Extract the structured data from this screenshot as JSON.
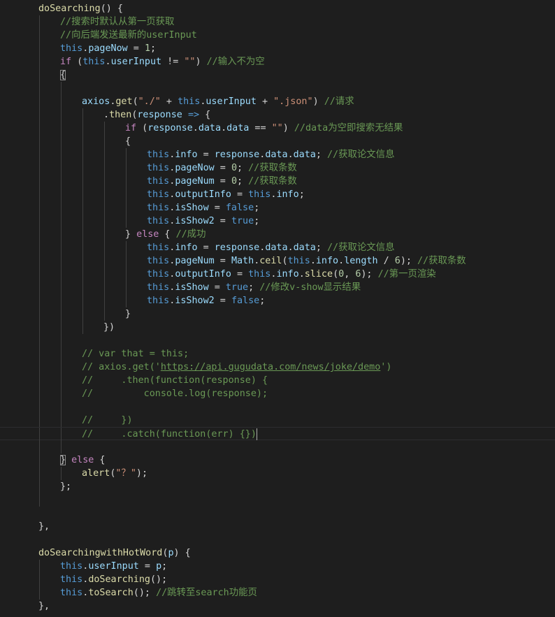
{
  "editor": {
    "language": "javascript",
    "theme": {
      "background": "#1e1e1e",
      "keyword": "#569cd6",
      "control": "#c586c0",
      "function": "#dcdcaa",
      "property": "#9cdcfe",
      "string": "#ce9178",
      "number": "#b5cea8",
      "comment": "#6a9955",
      "text": "#d4d4d4"
    },
    "lines": [
      {
        "indent": 1,
        "tokens": [
          [
            "fn",
            "doSearching"
          ],
          [
            "punc",
            "() {"
          ]
        ]
      },
      {
        "indent": 2,
        "tokens": [
          [
            "cmt",
            "//搜索时默认从第一页获取"
          ]
        ]
      },
      {
        "indent": 2,
        "tokens": [
          [
            "cmt",
            "//向后端发送最新的userInput"
          ]
        ]
      },
      {
        "indent": 2,
        "tokens": [
          [
            "kw",
            "this"
          ],
          [
            "punc",
            "."
          ],
          [
            "prop",
            "pageNow"
          ],
          [
            "punc",
            " = "
          ],
          [
            "num",
            "1"
          ],
          [
            "punc",
            ";"
          ]
        ]
      },
      {
        "indent": 2,
        "tokens": [
          [
            "ctrl",
            "if"
          ],
          [
            "punc",
            " ("
          ],
          [
            "kw",
            "this"
          ],
          [
            "punc",
            "."
          ],
          [
            "prop",
            "userInput"
          ],
          [
            "punc",
            " != "
          ],
          [
            "str",
            "\"\""
          ],
          [
            "punc",
            ") "
          ],
          [
            "cmt",
            "//输入不为空"
          ]
        ]
      },
      {
        "indent": 2,
        "tokens": [
          [
            "bracket",
            "{"
          ]
        ]
      },
      {
        "indent": 3,
        "tokens": []
      },
      {
        "indent": 3,
        "tokens": [
          [
            "prop",
            "axios"
          ],
          [
            "punc",
            "."
          ],
          [
            "fn",
            "get"
          ],
          [
            "punc",
            "("
          ],
          [
            "str",
            "\"./\""
          ],
          [
            "punc",
            " + "
          ],
          [
            "kw",
            "this"
          ],
          [
            "punc",
            "."
          ],
          [
            "prop",
            "userInput"
          ],
          [
            "punc",
            " + "
          ],
          [
            "str",
            "\".json\""
          ],
          [
            "punc",
            ") "
          ],
          [
            "cmt",
            "//请求"
          ]
        ]
      },
      {
        "indent": 4,
        "tokens": [
          [
            "punc",
            "."
          ],
          [
            "fn",
            "then"
          ],
          [
            "punc",
            "("
          ],
          [
            "prop",
            "response"
          ],
          [
            "punc",
            " "
          ],
          [
            "kw",
            "=>"
          ],
          [
            "punc",
            " {"
          ]
        ]
      },
      {
        "indent": 5,
        "tokens": [
          [
            "ctrl",
            "if"
          ],
          [
            "punc",
            " ("
          ],
          [
            "prop",
            "response"
          ],
          [
            "punc",
            "."
          ],
          [
            "prop",
            "data"
          ],
          [
            "punc",
            "."
          ],
          [
            "prop",
            "data"
          ],
          [
            "punc",
            " == "
          ],
          [
            "str",
            "\"\""
          ],
          [
            "punc",
            ") "
          ],
          [
            "cmt",
            "//data为空即搜索无结果"
          ]
        ]
      },
      {
        "indent": 5,
        "tokens": [
          [
            "punc",
            "{"
          ]
        ]
      },
      {
        "indent": 6,
        "tokens": [
          [
            "kw",
            "this"
          ],
          [
            "punc",
            "."
          ],
          [
            "prop",
            "info"
          ],
          [
            "punc",
            " = "
          ],
          [
            "prop",
            "response"
          ],
          [
            "punc",
            "."
          ],
          [
            "prop",
            "data"
          ],
          [
            "punc",
            "."
          ],
          [
            "prop",
            "data"
          ],
          [
            "punc",
            "; "
          ],
          [
            "cmt",
            "//获取论文信息"
          ]
        ]
      },
      {
        "indent": 6,
        "tokens": [
          [
            "kw",
            "this"
          ],
          [
            "punc",
            "."
          ],
          [
            "prop",
            "pageNow"
          ],
          [
            "punc",
            " = "
          ],
          [
            "num",
            "0"
          ],
          [
            "punc",
            "; "
          ],
          [
            "cmt",
            "//获取条数"
          ]
        ]
      },
      {
        "indent": 6,
        "tokens": [
          [
            "kw",
            "this"
          ],
          [
            "punc",
            "."
          ],
          [
            "prop",
            "pageNum"
          ],
          [
            "punc",
            " = "
          ],
          [
            "num",
            "0"
          ],
          [
            "punc",
            "; "
          ],
          [
            "cmt",
            "//获取条数"
          ]
        ]
      },
      {
        "indent": 6,
        "tokens": [
          [
            "kw",
            "this"
          ],
          [
            "punc",
            "."
          ],
          [
            "prop",
            "outputInfo"
          ],
          [
            "punc",
            " = "
          ],
          [
            "kw",
            "this"
          ],
          [
            "punc",
            "."
          ],
          [
            "prop",
            "info"
          ],
          [
            "punc",
            ";"
          ]
        ]
      },
      {
        "indent": 6,
        "tokens": [
          [
            "kw",
            "this"
          ],
          [
            "punc",
            "."
          ],
          [
            "prop",
            "isShow"
          ],
          [
            "punc",
            " = "
          ],
          [
            "kw",
            "false"
          ],
          [
            "punc",
            ";"
          ]
        ]
      },
      {
        "indent": 6,
        "tokens": [
          [
            "kw",
            "this"
          ],
          [
            "punc",
            "."
          ],
          [
            "prop",
            "isShow2"
          ],
          [
            "punc",
            " = "
          ],
          [
            "kw",
            "true"
          ],
          [
            "punc",
            ";"
          ]
        ]
      },
      {
        "indent": 5,
        "tokens": [
          [
            "punc",
            "} "
          ],
          [
            "ctrl",
            "else"
          ],
          [
            "punc",
            " { "
          ],
          [
            "cmt",
            "//成功"
          ]
        ]
      },
      {
        "indent": 6,
        "tokens": [
          [
            "kw",
            "this"
          ],
          [
            "punc",
            "."
          ],
          [
            "prop",
            "info"
          ],
          [
            "punc",
            " = "
          ],
          [
            "prop",
            "response"
          ],
          [
            "punc",
            "."
          ],
          [
            "prop",
            "data"
          ],
          [
            "punc",
            "."
          ],
          [
            "prop",
            "data"
          ],
          [
            "punc",
            "; "
          ],
          [
            "cmt",
            "//获取论文信息"
          ]
        ]
      },
      {
        "indent": 6,
        "tokens": [
          [
            "kw",
            "this"
          ],
          [
            "punc",
            "."
          ],
          [
            "prop",
            "pageNum"
          ],
          [
            "punc",
            " = "
          ],
          [
            "prop",
            "Math"
          ],
          [
            "punc",
            "."
          ],
          [
            "fn",
            "ceil"
          ],
          [
            "punc",
            "("
          ],
          [
            "kw",
            "this"
          ],
          [
            "punc",
            "."
          ],
          [
            "prop",
            "info"
          ],
          [
            "punc",
            "."
          ],
          [
            "prop",
            "length"
          ],
          [
            "punc",
            " / "
          ],
          [
            "num",
            "6"
          ],
          [
            "punc",
            "); "
          ],
          [
            "cmt",
            "//获取条数"
          ]
        ]
      },
      {
        "indent": 6,
        "tokens": [
          [
            "kw",
            "this"
          ],
          [
            "punc",
            "."
          ],
          [
            "prop",
            "outputInfo"
          ],
          [
            "punc",
            " = "
          ],
          [
            "kw",
            "this"
          ],
          [
            "punc",
            "."
          ],
          [
            "prop",
            "info"
          ],
          [
            "punc",
            "."
          ],
          [
            "fn",
            "slice"
          ],
          [
            "punc",
            "("
          ],
          [
            "num",
            "0"
          ],
          [
            "punc",
            ", "
          ],
          [
            "num",
            "6"
          ],
          [
            "punc",
            "); "
          ],
          [
            "cmt",
            "//第一页渲染"
          ]
        ]
      },
      {
        "indent": 6,
        "tokens": [
          [
            "kw",
            "this"
          ],
          [
            "punc",
            "."
          ],
          [
            "prop",
            "isShow"
          ],
          [
            "punc",
            " = "
          ],
          [
            "kw",
            "true"
          ],
          [
            "punc",
            "; "
          ],
          [
            "cmt",
            "//修改v-show显示结果"
          ]
        ]
      },
      {
        "indent": 6,
        "tokens": [
          [
            "kw",
            "this"
          ],
          [
            "punc",
            "."
          ],
          [
            "prop",
            "isShow2"
          ],
          [
            "punc",
            " = "
          ],
          [
            "kw",
            "false"
          ],
          [
            "punc",
            ";"
          ]
        ]
      },
      {
        "indent": 5,
        "tokens": [
          [
            "punc",
            "}"
          ]
        ]
      },
      {
        "indent": 4,
        "tokens": [
          [
            "punc",
            "})"
          ]
        ]
      },
      {
        "indent": 3,
        "tokens": []
      },
      {
        "indent": 3,
        "tokens": [
          [
            "cmt",
            "// var that = this;"
          ]
        ]
      },
      {
        "indent": 3,
        "tokens": [
          [
            "cmt",
            "// axios.get('"
          ],
          [
            "link",
            "https://api.gugudata.com/news/joke/demo"
          ],
          [
            "cmt",
            "')"
          ]
        ]
      },
      {
        "indent": 3,
        "tokens": [
          [
            "cmt",
            "//     .then(function(response) {"
          ]
        ]
      },
      {
        "indent": 3,
        "tokens": [
          [
            "cmt",
            "//         console.log(response);"
          ]
        ]
      },
      {
        "indent": 3,
        "tokens": []
      },
      {
        "indent": 3,
        "tokens": [
          [
            "cmt",
            "//     })"
          ]
        ]
      },
      {
        "indent": 3,
        "current": true,
        "tokens": [
          [
            "cmt",
            "//     .catch(function(err) {})"
          ],
          [
            "cursor",
            ""
          ]
        ]
      },
      {
        "indent": 3,
        "tokens": []
      },
      {
        "indent": 2,
        "tokens": [
          [
            "bracket",
            "}"
          ],
          [
            "punc",
            " "
          ],
          [
            "ctrl",
            "else"
          ],
          [
            "punc",
            " {"
          ]
        ]
      },
      {
        "indent": 3,
        "tokens": [
          [
            "fn",
            "alert"
          ],
          [
            "punc",
            "("
          ],
          [
            "str",
            "\"？\""
          ],
          [
            "punc",
            ");"
          ]
        ]
      },
      {
        "indent": 2,
        "tokens": [
          [
            "punc",
            "};"
          ]
        ]
      },
      {
        "indent": 2,
        "tokens": []
      },
      {
        "indent": 1,
        "tokens": []
      },
      {
        "indent": 1,
        "tokens": [
          [
            "punc",
            "},"
          ]
        ]
      },
      {
        "indent": 1,
        "tokens": []
      },
      {
        "indent": 1,
        "tokens": [
          [
            "fn",
            "doSearchingwithHotWord"
          ],
          [
            "punc",
            "("
          ],
          [
            "prop",
            "p"
          ],
          [
            "punc",
            ") {"
          ]
        ]
      },
      {
        "indent": 2,
        "tokens": [
          [
            "kw",
            "this"
          ],
          [
            "punc",
            "."
          ],
          [
            "prop",
            "userInput"
          ],
          [
            "punc",
            " = "
          ],
          [
            "prop",
            "p"
          ],
          [
            "punc",
            ";"
          ]
        ]
      },
      {
        "indent": 2,
        "tokens": [
          [
            "kw",
            "this"
          ],
          [
            "punc",
            "."
          ],
          [
            "fn",
            "doSearching"
          ],
          [
            "punc",
            "();"
          ]
        ]
      },
      {
        "indent": 2,
        "tokens": [
          [
            "kw",
            "this"
          ],
          [
            "punc",
            "."
          ],
          [
            "fn",
            "toSearch"
          ],
          [
            "punc",
            "(); "
          ],
          [
            "cmt",
            "//跳转至search功能页"
          ]
        ]
      },
      {
        "indent": 1,
        "tokens": [
          [
            "punc",
            "},"
          ]
        ]
      }
    ]
  }
}
